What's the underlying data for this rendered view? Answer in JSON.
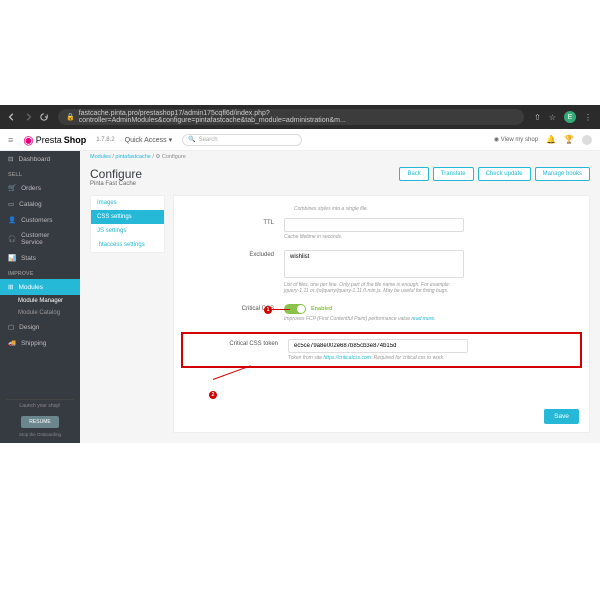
{
  "browser": {
    "url": "fastcache.pinta.pro/prestashop17/admin175cqfl6d/index.php?controller=AdminModules&configure=pintafastcache&tab_module=administration&m...",
    "avatar_letter": "E"
  },
  "topbar": {
    "brand_prefix": "Presta",
    "brand_suffix": "Shop",
    "version": "1.7.8.2",
    "quick_access": "Quick Access",
    "search_placeholder": "Search",
    "view_shop": "View my shop"
  },
  "sidebar": {
    "dashboard": "Dashboard",
    "heading_sell": "SELL",
    "orders": "Orders",
    "catalog": "Catalog",
    "customers": "Customers",
    "customer_service": "Customer Service",
    "stats": "Stats",
    "heading_improve": "IMPROVE",
    "modules": "Modules",
    "module_manager": "Module Manager",
    "module_catalog": "Module Catalog",
    "design": "Design",
    "shipping": "Shipping",
    "launch": "Launch your shop!",
    "resume_btn": "RESUME",
    "stop_link": "Stop the OnBoarding"
  },
  "breadcrumbs": {
    "a": "Modules",
    "b": "pintafastcache",
    "c": "Configure"
  },
  "header": {
    "title": "Configure",
    "subtitle": "Pinta Fast Cache",
    "back": "Back",
    "translate": "Translate",
    "check_update": "Check update",
    "manage_hooks": "Manage hooks"
  },
  "tabs": {
    "images": "Images",
    "css": "CSS settings",
    "js": "JS settings",
    "htaccess": ".htaccess settings"
  },
  "form": {
    "combine_help": "Combines styles into a single file.",
    "ttl_label": "TTL",
    "ttl_help": "Cache lifetime in seconds.",
    "excluded_label": "Excluded",
    "excluded_value": "wishlist",
    "excluded_help": "List of files, one per line. Only part of the file name is enough. For example: jquery-1.11 or /js/jquery/jquery-1.11.0.min.js. May be useful for fixing bugs.",
    "critical_label": "Critical CSS",
    "critical_enabled": "Enabled",
    "critical_help": "Improves FCP (First Contentful Paint) performance value",
    "critical_more": "read more",
    "token_label": "Critical CSS token",
    "token_value": "ec5ce79a8e002e687b85cb3e874b15d",
    "token_help_pre": "Token from site",
    "token_link": "https://criticalcss.com",
    "token_help_post": ". Required for critical css to work.",
    "save": "Save"
  },
  "markers": {
    "one": "1",
    "two": "2"
  }
}
